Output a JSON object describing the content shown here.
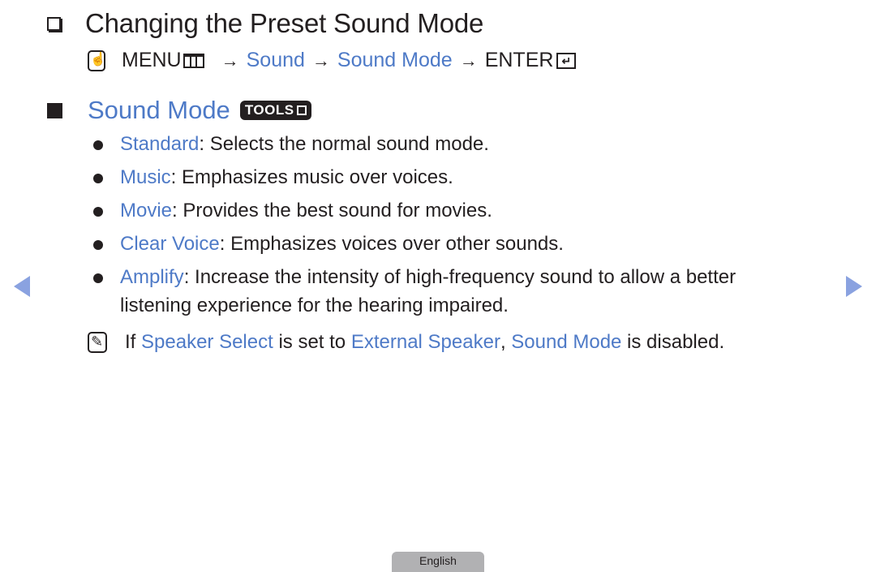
{
  "header": {
    "title": "Changing the Preset Sound Mode"
  },
  "menu_path": {
    "menu_label": "MENU",
    "arrow": "→",
    "step1": "Sound",
    "step2": "Sound Mode",
    "enter_label": "ENTER",
    "icons": [
      "remote-hand-icon",
      "menu-bars-icon",
      "enter-icon"
    ]
  },
  "section": {
    "title": "Sound Mode",
    "tools_label": "TOOLS"
  },
  "bullets": [
    {
      "term": "Standard",
      "desc": ": Selects the normal sound mode."
    },
    {
      "term": "Music",
      "desc": ": Emphasizes music over voices."
    },
    {
      "term": "Movie",
      "desc": ": Provides the best sound for movies."
    },
    {
      "term": "Clear Voice",
      "desc": ": Emphasizes voices over other sounds."
    },
    {
      "term": "Amplify",
      "desc": ": Increase the intensity of high-frequency sound to allow a better listening experience for the hearing impaired."
    }
  ],
  "note": {
    "prefix": "If ",
    "term1": "Speaker Select",
    "mid": " is set to ",
    "term2": "External Speaker",
    "comma": ", ",
    "term3": "Sound Mode",
    "suffix": " is disabled."
  },
  "navigation": {
    "prev_icon": "triangle-left-icon",
    "next_icon": "triangle-right-icon"
  },
  "footer": {
    "language_tab": "English"
  },
  "colors": {
    "accent": "#4e7ac7",
    "text": "#231f20",
    "nav_arrow": "#8aa2e0",
    "tab_bg": "#b1b1b3"
  }
}
